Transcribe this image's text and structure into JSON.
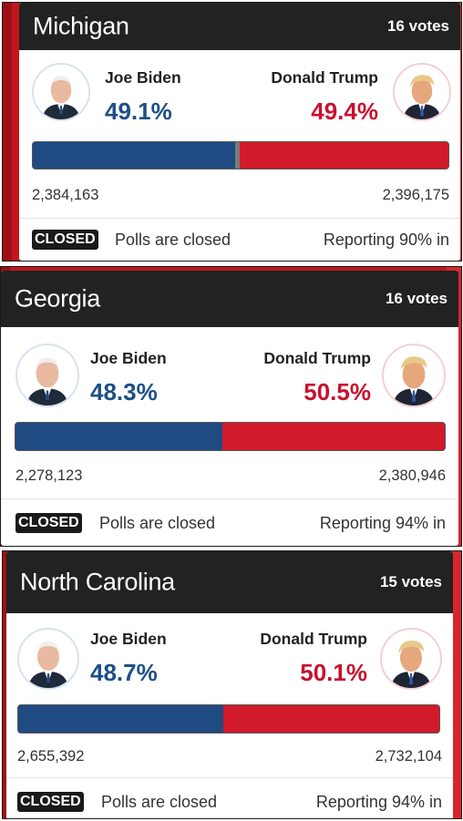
{
  "states": [
    {
      "name": "Michigan",
      "electoral_votes": "16 votes",
      "biden": {
        "name": "Joe Biden",
        "pct": "49.1%",
        "votes": "2,384,163"
      },
      "trump": {
        "name": "Donald Trump",
        "pct": "49.4%",
        "votes": "2,396,175"
      },
      "biden_share": 0.491,
      "status_badge": "CLOSED",
      "status_text": "Polls are closed",
      "reporting": "Reporting 90% in"
    },
    {
      "name": "Georgia",
      "electoral_votes": "16 votes",
      "biden": {
        "name": "Joe Biden",
        "pct": "48.3%",
        "votes": "2,278,123"
      },
      "trump": {
        "name": "Donald Trump",
        "pct": "50.5%",
        "votes": "2,380,946"
      },
      "biden_share": 0.483,
      "status_badge": "CLOSED",
      "status_text": "Polls are closed",
      "reporting": "Reporting 94% in"
    },
    {
      "name": "North Carolina",
      "electoral_votes": "15 votes",
      "biden": {
        "name": "Joe Biden",
        "pct": "48.7%",
        "votes": "2,655,392"
      },
      "trump": {
        "name": "Donald Trump",
        "pct": "50.1%",
        "votes": "2,732,104"
      },
      "biden_share": 0.487,
      "status_badge": "CLOSED",
      "status_text": "Polls are closed",
      "reporting": "Reporting 94% in"
    }
  ],
  "colors": {
    "democrat": "#1f4b82",
    "republican": "#d11a2a",
    "header": "#222222",
    "background": "#c1161d"
  },
  "icons": {
    "biden_avatar": "biden-portrait",
    "trump_avatar": "trump-portrait"
  }
}
